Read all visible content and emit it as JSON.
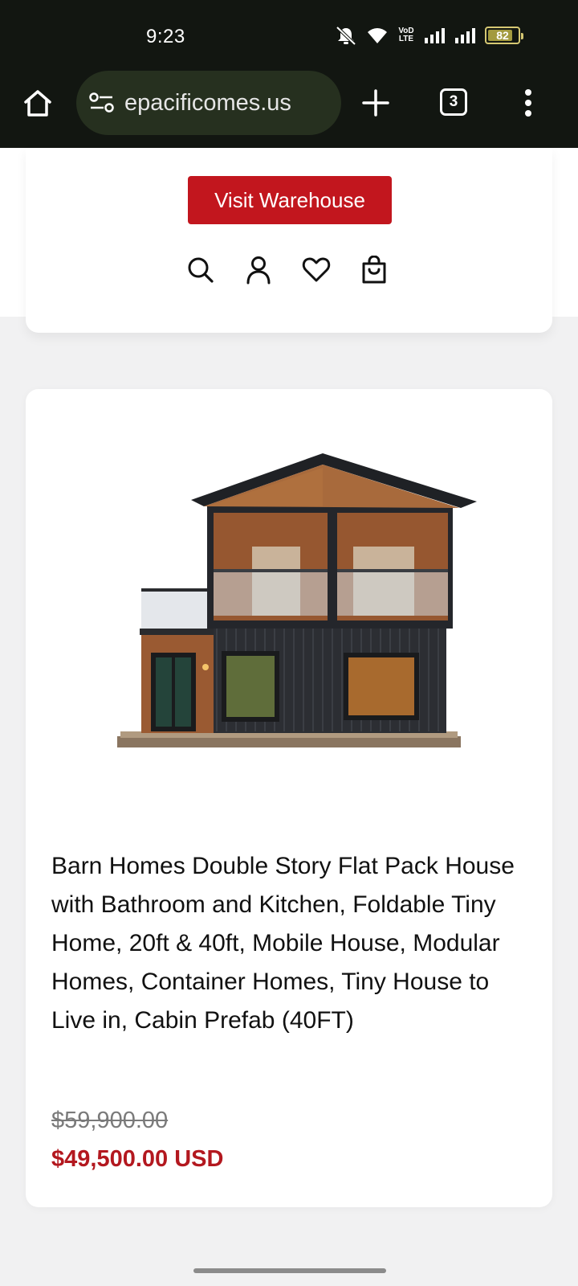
{
  "status_bar": {
    "time": "9:23",
    "battery": "82",
    "battery_level": 0.82,
    "network_label": "VoD LTE"
  },
  "browser": {
    "url": "epacificomes.us",
    "tab_count": "3"
  },
  "header": {
    "visit_button": "Visit Warehouse",
    "icons": [
      "search-icon",
      "account-icon",
      "wishlist-icon",
      "cart-icon"
    ]
  },
  "product": {
    "title": "Barn Homes Double Story Flat Pack House with Bathroom and Kitchen, Foldable Tiny Home, 20ft & 40ft, Mobile House, Modular Homes, Container Homes, Tiny House to Live in, Cabin Prefab (40FT)",
    "compare_price": "$59,900.00",
    "price": "$49,500.00 USD"
  },
  "colors": {
    "brand_red": "#c2161e",
    "price_red": "#b3181f",
    "chrome_dark": "#121611"
  }
}
